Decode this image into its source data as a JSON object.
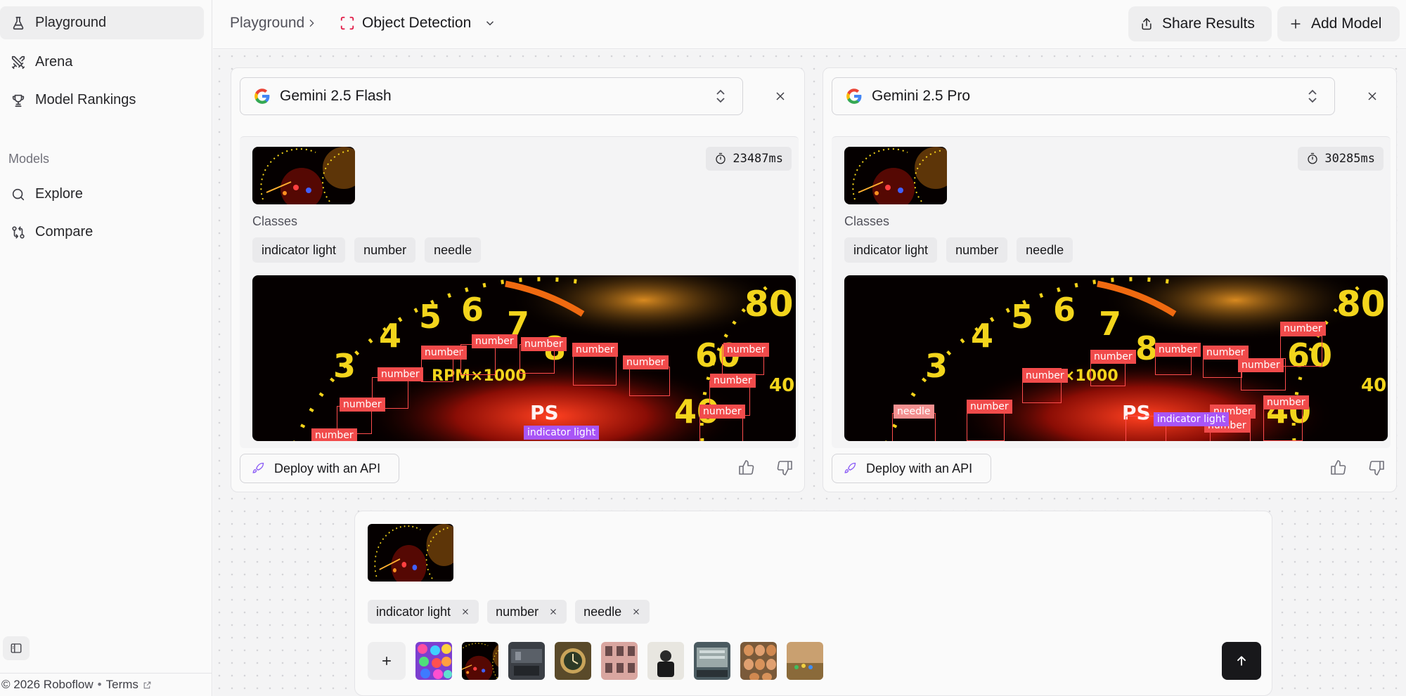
{
  "sidebar": {
    "items": [
      {
        "label": "Playground",
        "icon": "flask-icon",
        "active": true
      },
      {
        "label": "Arena",
        "icon": "swords-icon",
        "active": false
      },
      {
        "label": "Model Rankings",
        "icon": "trophy-icon",
        "active": false
      }
    ],
    "section_label": "Models",
    "model_items": [
      {
        "label": "Explore",
        "icon": "search-icon"
      },
      {
        "label": "Compare",
        "icon": "compare-icon"
      }
    ],
    "footer": {
      "copyright": "© 2026 Roboflow",
      "separator": "•",
      "terms": "Terms"
    }
  },
  "header": {
    "breadcrumb_root": "Playground",
    "breadcrumb_current": "Object Detection",
    "share_label": "Share Results",
    "add_label": "Add Model"
  },
  "panels": [
    {
      "model": "Gemini 2.5 Flash",
      "timing": "23487ms",
      "classes_label": "Classes",
      "classes": [
        "indicator light",
        "number",
        "needle"
      ],
      "deploy_label": "Deploy with an API",
      "detections": [
        {
          "label": "number"
        },
        {
          "label": "number"
        },
        {
          "label": "number"
        },
        {
          "label": "number"
        },
        {
          "label": "number"
        },
        {
          "label": "number"
        },
        {
          "label": "number"
        },
        {
          "label": "number"
        },
        {
          "label": "number"
        },
        {
          "label": "number"
        },
        {
          "label": "number"
        },
        {
          "label": "indicator light"
        }
      ]
    },
    {
      "model": "Gemini 2.5 Pro",
      "timing": "30285ms",
      "classes_label": "Classes",
      "classes": [
        "indicator light",
        "number",
        "needle"
      ],
      "deploy_label": "Deploy with an API",
      "detections": [
        {
          "label": "needle"
        },
        {
          "label": "number"
        },
        {
          "label": "number"
        },
        {
          "label": "number"
        },
        {
          "label": "number"
        },
        {
          "label": "number"
        },
        {
          "label": "number"
        },
        {
          "label": "number"
        },
        {
          "label": "number"
        },
        {
          "label": "number"
        },
        {
          "label": "number"
        },
        {
          "label": "indicator light"
        }
      ]
    }
  ],
  "composer": {
    "classes": [
      "indicator light",
      "number",
      "needle"
    ],
    "sample_images": [
      "candy",
      "dashboard",
      "workshop",
      "clock",
      "building",
      "person",
      "machine",
      "eggs",
      "outdoor"
    ]
  },
  "colors": {
    "accent": "#18181b",
    "detection_red": "#f14b4b",
    "detection_purple": "#a855f7",
    "deploy_icon": "#8b5cf6",
    "breadcrumb_icon": "#e11d48"
  }
}
